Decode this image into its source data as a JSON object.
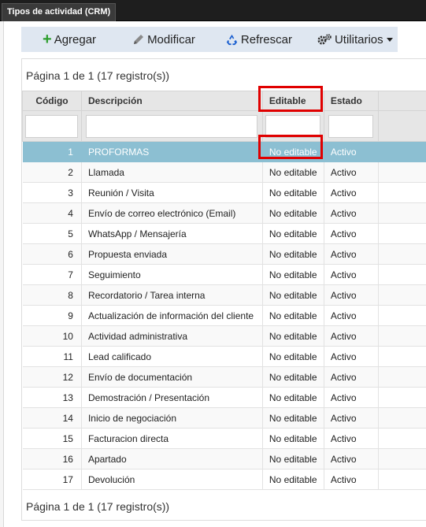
{
  "window": {
    "tab_title": "Tipos de actividad (CRM)"
  },
  "toolbar": {
    "add_label": "Agregar",
    "modify_label": "Modificar",
    "refresh_label": "Refrescar",
    "utilities_label": "Utilitarios"
  },
  "pager": {
    "top_text": "Página 1 de 1 (17 registro(s))",
    "bottom_text": "Página 1 de 1 (17 registro(s))"
  },
  "columns": {
    "code": "Código",
    "description": "Descripción",
    "editable": "Editable",
    "status": "Estado"
  },
  "filters": {
    "code": "",
    "description": "",
    "editable": "",
    "status": ""
  },
  "selected_row": 1,
  "rows": [
    {
      "code": "1",
      "description": "PROFORMAS",
      "editable": "No editable",
      "status": "Activo"
    },
    {
      "code": "2",
      "description": "Llamada",
      "editable": "No editable",
      "status": "Activo"
    },
    {
      "code": "3",
      "description": "Reunión / Visita",
      "editable": "No editable",
      "status": "Activo"
    },
    {
      "code": "4",
      "description": "Envío de correo electrónico (Email)",
      "editable": "No editable",
      "status": "Activo"
    },
    {
      "code": "5",
      "description": "WhatsApp / Mensajería",
      "editable": "No editable",
      "status": "Activo"
    },
    {
      "code": "6",
      "description": "Propuesta enviada",
      "editable": "No editable",
      "status": "Activo"
    },
    {
      "code": "7",
      "description": "Seguimiento",
      "editable": "No editable",
      "status": "Activo"
    },
    {
      "code": "8",
      "description": "Recordatorio / Tarea interna",
      "editable": "No editable",
      "status": "Activo"
    },
    {
      "code": "9",
      "description": "Actualización de información del cliente",
      "editable": "No editable",
      "status": "Activo"
    },
    {
      "code": "10",
      "description": "Actividad administrativa",
      "editable": "No editable",
      "status": "Activo"
    },
    {
      "code": "11",
      "description": "Lead calificado",
      "editable": "No editable",
      "status": "Activo"
    },
    {
      "code": "12",
      "description": "Envío de documentación",
      "editable": "No editable",
      "status": "Activo"
    },
    {
      "code": "13",
      "description": "Demostración / Presentación",
      "editable": "No editable",
      "status": "Activo"
    },
    {
      "code": "14",
      "description": "Inicio de negociación",
      "editable": "No editable",
      "status": "Activo"
    },
    {
      "code": "15",
      "description": "Facturacion directa",
      "editable": "No editable",
      "status": "Activo"
    },
    {
      "code": "16",
      "description": "Apartado",
      "editable": "No editable",
      "status": "Activo"
    },
    {
      "code": "17",
      "description": "Devolución",
      "editable": "No editable",
      "status": "Activo"
    }
  ],
  "colors": {
    "selected_row_bg": "#8cbfd2",
    "highlight_box": "#e00000",
    "toolbar_bg": "#dfe7f1",
    "add_icon": "#2e9e2e",
    "refresh_icon": "#1a5fd0"
  },
  "icons": {
    "add": "plus-icon",
    "modify": "pencil-icon",
    "refresh": "recycle-icon",
    "utilities": "gears-icon"
  }
}
